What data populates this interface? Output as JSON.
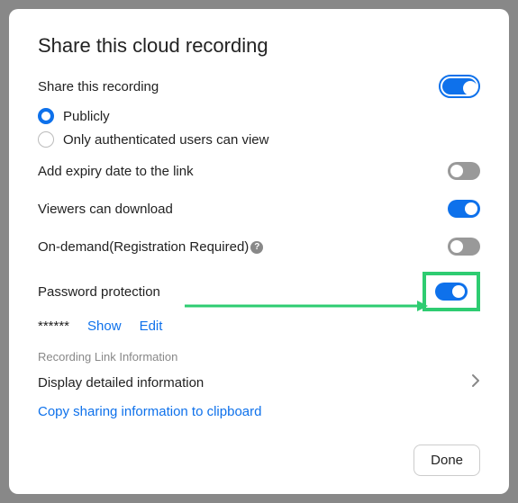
{
  "modal": {
    "title": "Share this cloud recording",
    "shareRecording": {
      "label": "Share this recording",
      "enabled": true,
      "options": {
        "publicly": "Publicly",
        "authenticated": "Only authenticated users can view"
      },
      "selected": "publicly"
    },
    "expiry": {
      "label": "Add expiry date to the link",
      "enabled": false
    },
    "download": {
      "label": "Viewers can download",
      "enabled": true
    },
    "onDemand": {
      "label": "On-demand(Registration Required)",
      "enabled": false
    },
    "password": {
      "label": "Password protection",
      "enabled": true,
      "mask": "******",
      "showLabel": "Show",
      "editLabel": "Edit"
    },
    "linkInfo": {
      "header": "Recording Link Information",
      "displayLabel": "Display detailed information",
      "copyLabel": "Copy sharing information to clipboard"
    },
    "doneLabel": "Done"
  }
}
